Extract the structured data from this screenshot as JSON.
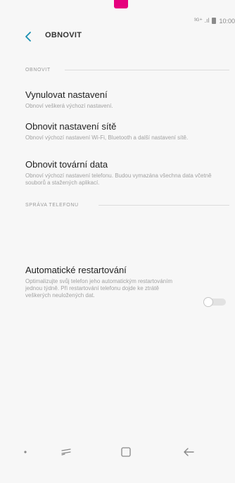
{
  "status_bar": {
    "text": "³ᴳ⁺ .ıl",
    "time": "10:00"
  },
  "header": {
    "title": "OBNOVIT"
  },
  "sections": [
    {
      "header": "OBNOVIT",
      "items": [
        {
          "title": "Vynulovat nastavení",
          "description": "Obnoví veškerá výchozí nastavení."
        },
        {
          "title": "Obnovit nastavení sítě",
          "description": "Obnoví výchozí nastavení Wi-Fi, Bluetooth a další nastavení sítě."
        },
        {
          "title": "Obnovit tovární data",
          "description": "Obnoví výchozí nastavení telefonu. Budou vymazána všechna data včetně souborů a stažených aplikací."
        }
      ]
    },
    {
      "header": "SPRÁVA TELEFONU",
      "items": [
        {
          "title": "Automatické restartování",
          "description": "Optimalizujte svůj telefon jeho automatickým restartováním jednou týdně. Při restartování telefonu dojde ke ztrátě veškerých neuložených dat.",
          "toggle_state": "off"
        }
      ]
    }
  ],
  "nav_bar": {
    "icons": [
      "dot-icon",
      "recent-apps-icon",
      "home-icon",
      "back-icon"
    ]
  },
  "colors": {
    "brand_magenta": "#e6007e",
    "accent_teal": "#1a8fb0",
    "background": "#f7f7f7"
  }
}
